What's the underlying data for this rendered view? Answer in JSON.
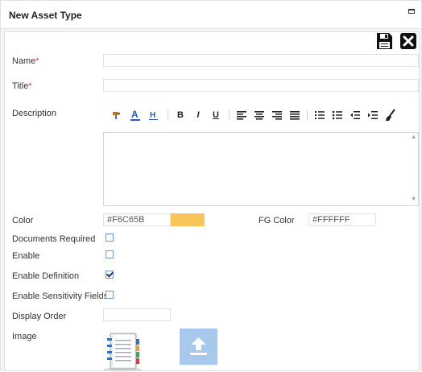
{
  "dialog": {
    "title": "New Asset Type"
  },
  "fields": {
    "name_label": "Name",
    "title_label": "Title",
    "required_mark": "*",
    "description_label": "Description",
    "color_label": "Color",
    "color_value": "#F6C65B",
    "fg_color_label": "FG Color",
    "fg_color_value": "#FFFFFF",
    "documents_required_label": "Documents Required",
    "enable_label": "Enable",
    "enable_definition_label": "Enable Definition",
    "enable_sensitivity_label": "Enable Sensitivity Fields",
    "display_order_label": "Display Order",
    "image_label": "Image"
  },
  "toolbar": {
    "bold": "B",
    "italic": "I",
    "underline": "U",
    "font_color": "A",
    "highlight": "H"
  },
  "checkboxes": {
    "documents_required": false,
    "enable": false,
    "enable_definition": true,
    "enable_sensitivity_fields": false
  },
  "colors": {
    "swatch": "#F6C65B",
    "accent": "#1a3f7a",
    "upload_bg": "#a9c8ee"
  },
  "icons": [
    "save-icon",
    "close-icon",
    "maximize-icon",
    "format-painter-icon",
    "font-color-icon",
    "highlight-icon",
    "align-left-icon",
    "align-center-icon",
    "align-right-icon",
    "justify-icon",
    "numbered-list-icon",
    "bullet-list-icon",
    "outdent-icon",
    "indent-icon",
    "clear-format-icon",
    "asset-type-book-icon",
    "upload-icon"
  ]
}
